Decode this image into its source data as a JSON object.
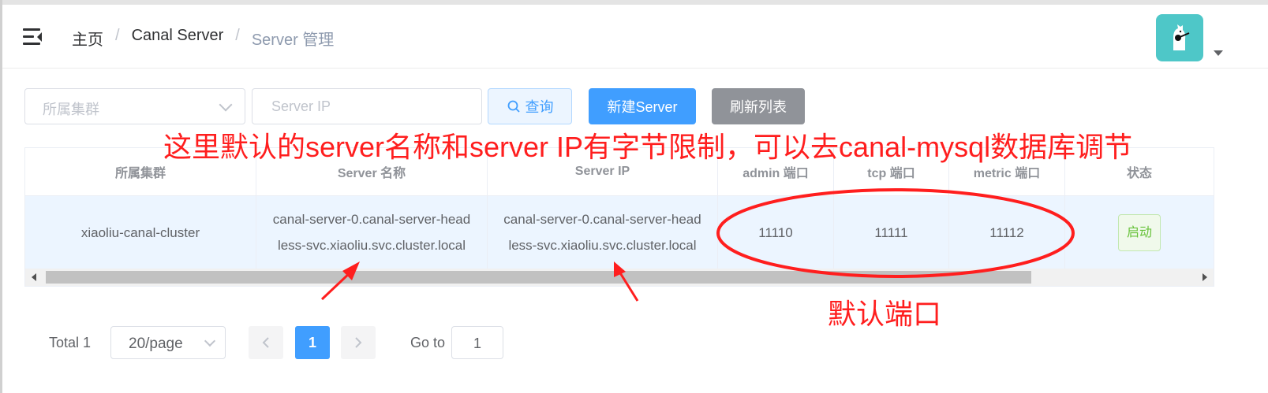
{
  "breadcrumb": {
    "items": [
      "主页",
      "Canal Server"
    ],
    "separator": "/",
    "current": "Server 管理"
  },
  "toolbar": {
    "cluster_placeholder": "所属集群",
    "ip_placeholder": "Server IP",
    "query_label": "查询",
    "new_label": "新建Server",
    "refresh_label": "刷新列表"
  },
  "annotations": {
    "top": "这里默认的server名称和server IP有字节限制，可以去canal-mysql数据库调节",
    "bottom": "默认端口"
  },
  "table": {
    "headers": [
      "所属集群",
      "Server 名称",
      "Server IP",
      "admin 端口",
      "tcp 端口",
      "metric 端口",
      "状态"
    ],
    "rows": [
      {
        "cluster": "xiaoliu-canal-cluster",
        "name_line1": "canal-server-0.canal-server-head",
        "name_line2": "less-svc.xiaoliu.svc.cluster.local",
        "ip_line1": "canal-server-0.canal-server-head",
        "ip_line2": "less-svc.xiaoliu.svc.cluster.local",
        "admin_port": "11110",
        "tcp_port": "11111",
        "metric_port": "11112",
        "status": "启动"
      }
    ]
  },
  "pagination": {
    "total": "Total 1",
    "page_size": "20/page",
    "current_page": "1",
    "goto_label": "Go to",
    "goto_value": "1"
  },
  "colors": {
    "primary": "#409eff",
    "annotation_red": "#ff1e1e",
    "success": "#67c23a",
    "avatar_bg": "#4ec7c8"
  },
  "icons": [
    "hamburger-icon",
    "search-icon",
    "chevron-down-icon",
    "chevron-left-icon",
    "chevron-right-icon",
    "avatar-icon",
    "caret-down-icon"
  ]
}
